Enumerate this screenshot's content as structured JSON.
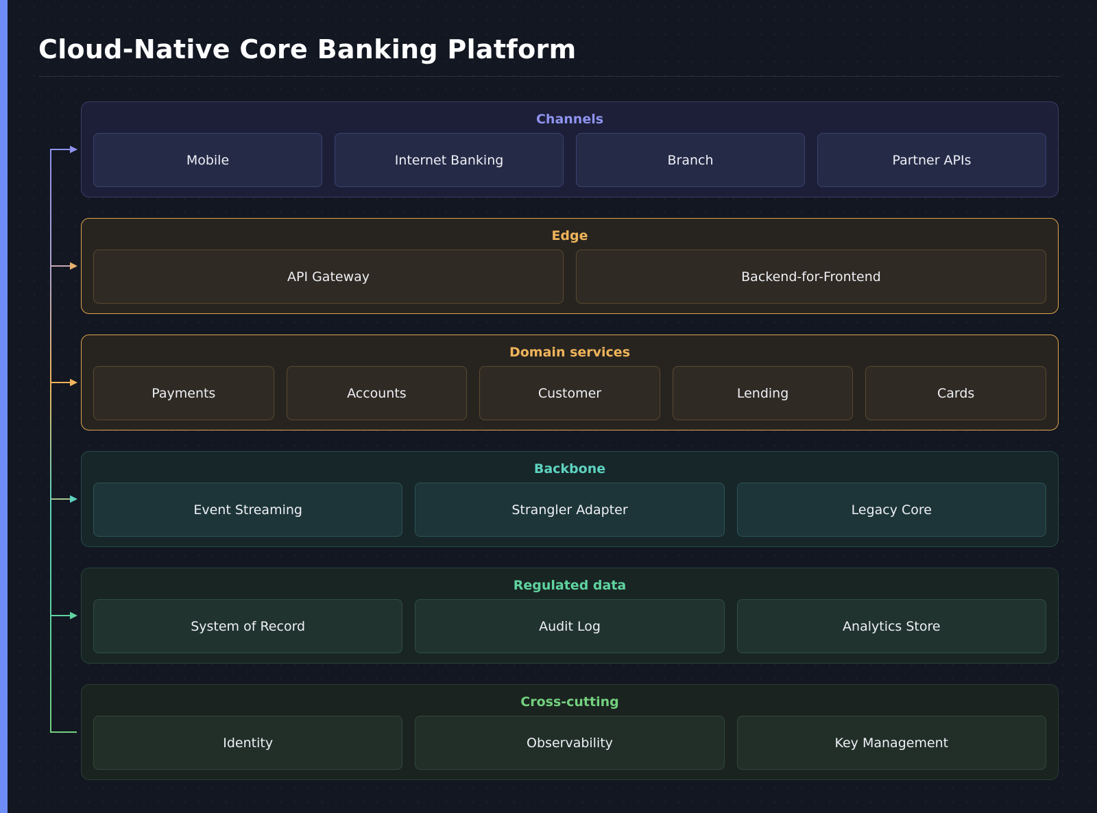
{
  "title": "Cloud-Native Core Banking Platform",
  "colors": {
    "accent_bar": "#6d8cf5",
    "background": "#121722",
    "channels": "#8f93ef",
    "edge": "#f0b45a",
    "domain_services": "#f0b45a",
    "backbone": "#5ed3c0",
    "regulated_data": "#5fd3a0",
    "cross_cutting": "#74d17f"
  },
  "layers": [
    {
      "title": "Channels",
      "nodes": [
        "Mobile",
        "Internet Banking",
        "Branch",
        "Partner APIs"
      ]
    },
    {
      "title": "Edge",
      "nodes": [
        "API Gateway",
        "Backend-for-Frontend"
      ]
    },
    {
      "title": "Domain services",
      "nodes": [
        "Payments",
        "Accounts",
        "Customer",
        "Lending",
        "Cards"
      ]
    },
    {
      "title": "Backbone",
      "nodes": [
        "Event Streaming",
        "Strangler Adapter",
        "Legacy Core"
      ]
    },
    {
      "title": "Regulated data",
      "nodes": [
        "System of Record",
        "Audit Log",
        "Analytics Store"
      ]
    },
    {
      "title": "Cross-cutting",
      "nodes": [
        "Identity",
        "Observability",
        "Key Management"
      ]
    }
  ]
}
